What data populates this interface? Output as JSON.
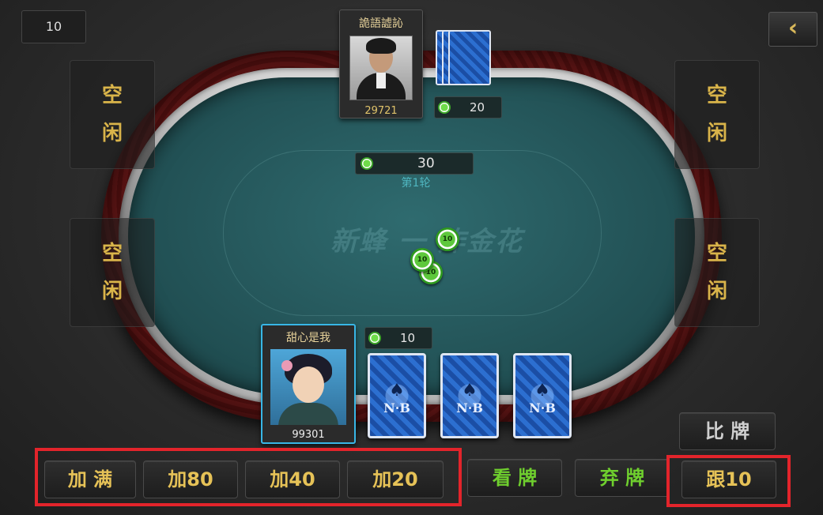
{
  "top_counter": "10",
  "back_icon": "chevron-left-icon",
  "empty_seats": [
    {
      "line1": "空",
      "line2": "闲"
    },
    {
      "line1": "空",
      "line2": "闲"
    },
    {
      "line1": "空",
      "line2": "闲"
    },
    {
      "line1": "空",
      "line2": "闲"
    }
  ],
  "opponent": {
    "name": "詭語譃訫",
    "score": "29721",
    "bet": "20"
  },
  "pot": {
    "amount": "30",
    "round": "第1轮"
  },
  "watermark": "新蜂 一 炸金花",
  "pot_chips": [
    "10",
    "10",
    "10"
  ],
  "self": {
    "name": "甜心是我",
    "score": "99301",
    "bet": "10"
  },
  "card_logo": "N·B",
  "buttons": {
    "max_raise": "加 满",
    "raise80": "加80",
    "raise40": "加40",
    "raise20": "加20",
    "look": "看 牌",
    "fold": "弃 牌",
    "call": "跟10",
    "compare": "比 牌"
  },
  "colors": {
    "highlight": "#e3242b",
    "gold": "#e6c257",
    "green": "#6fcf2e"
  }
}
